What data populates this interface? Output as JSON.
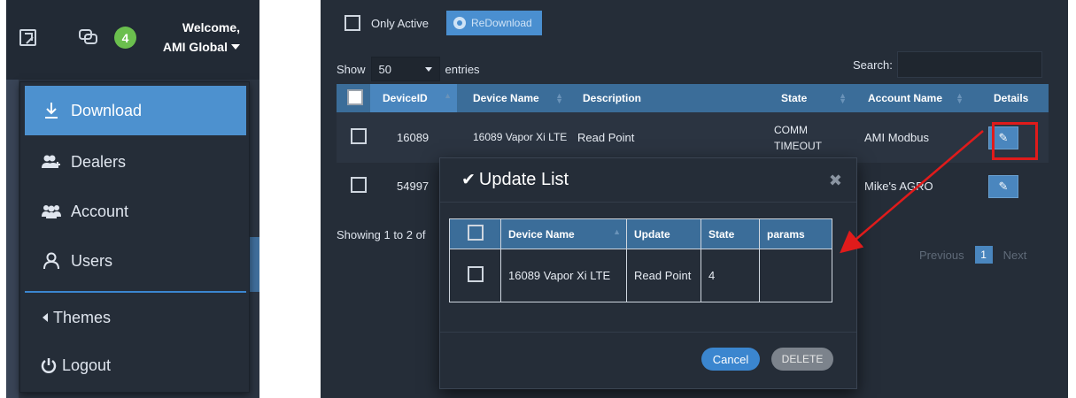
{
  "left": {
    "welcome_line1": "Welcome,",
    "welcome_line2": "AMI Global",
    "notification_count": "4",
    "menu": [
      {
        "label": "Download",
        "icon": "download-icon",
        "active": true
      },
      {
        "label": "Dealers",
        "icon": "add-users-icon"
      },
      {
        "label": "Account",
        "icon": "users-group-icon"
      },
      {
        "label": "Users",
        "icon": "user-icon"
      },
      {
        "label": "Themes",
        "icon": "caret-left-icon"
      },
      {
        "label": "Logout",
        "icon": "power-icon"
      }
    ]
  },
  "toolbar": {
    "only_active_label": "Only Active",
    "redownload_label": "ReDownload"
  },
  "table_controls": {
    "show_label": "Show",
    "page_size": "50",
    "entries_label": "entries",
    "search_label": "Search:",
    "search_value": ""
  },
  "devices_table": {
    "columns": [
      "DeviceID",
      "Device Name",
      "Description",
      "State",
      "Account Name",
      "Details"
    ],
    "rows": [
      {
        "device_id": "16089",
        "device_name": "16089 Vapor Xi LTE",
        "description": "Read Point",
        "state": "COMM TIMEOUT",
        "account_name": "AMI Modbus"
      },
      {
        "device_id": "54997",
        "device_name": "",
        "description": "",
        "state": "",
        "account_name": "Mike's AGRO"
      }
    ]
  },
  "footer": {
    "showing_text": "Showing 1 to 2 of",
    "previous_label": "Previous",
    "current_page": "1",
    "next_label": "Next"
  },
  "modal": {
    "title": "Update List",
    "columns": [
      "Device Name",
      "Update",
      "State",
      "params"
    ],
    "rows": [
      {
        "device_name": "16089 Vapor Xi LTE",
        "update": "Read Point",
        "state": "4",
        "params": ""
      }
    ],
    "cancel_label": "Cancel",
    "delete_label": "DELETE"
  },
  "colors": {
    "accent": "#4a86be",
    "highlight": "#e01b1b",
    "badge": "#6bbf4e"
  }
}
